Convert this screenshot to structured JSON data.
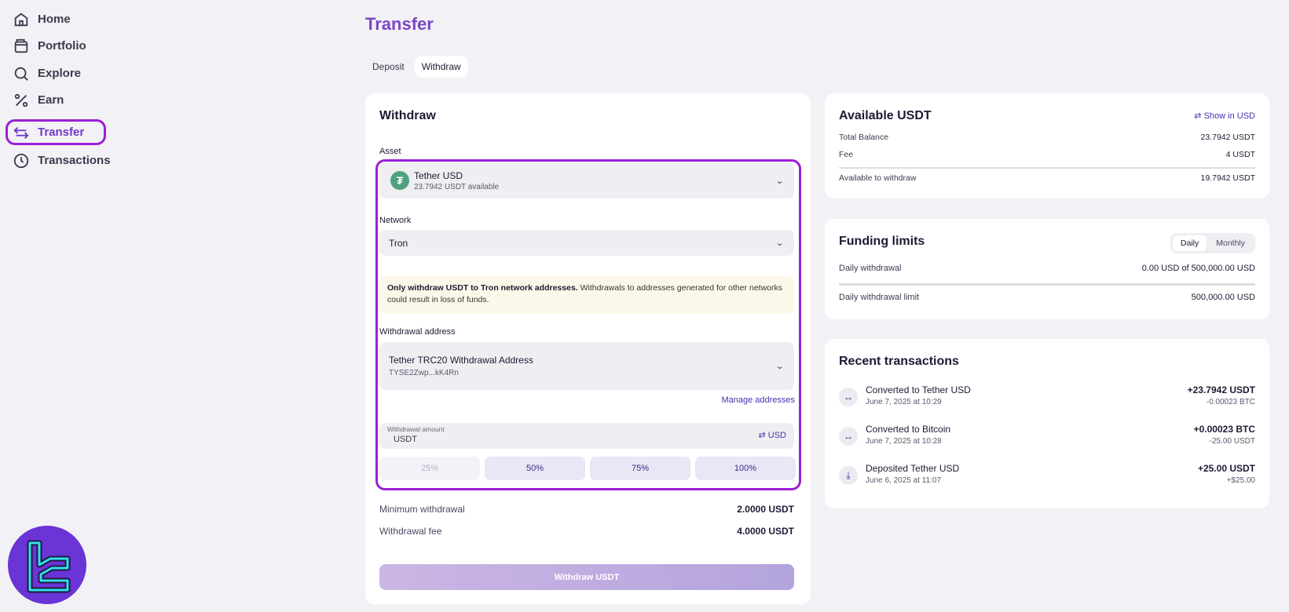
{
  "sidebar": {
    "items": [
      {
        "label": "Home",
        "icon": "home-icon"
      },
      {
        "label": "Portfolio",
        "icon": "wallet-icon"
      },
      {
        "label": "Explore",
        "icon": "search-icon"
      },
      {
        "label": "Earn",
        "icon": "percent-icon"
      },
      {
        "label": "Transfer",
        "icon": "transfer-arrows-icon",
        "active": true
      },
      {
        "label": "Transactions",
        "icon": "clock-icon"
      }
    ]
  },
  "page": {
    "title": "Transfer",
    "tabs": [
      {
        "label": "Deposit"
      },
      {
        "label": "Withdraw",
        "active": true
      }
    ]
  },
  "withdraw": {
    "title": "Withdraw",
    "asset_label": "Asset",
    "asset_name": "Tether USD",
    "asset_available": "23.7942 USDT available",
    "asset_icon": "tether-icon",
    "network_label": "Network",
    "network_value": "Tron",
    "warning_bold": "Only withdraw USDT to Tron network addresses.",
    "warning_text": " Withdrawals to addresses generated for other networks could result in loss of funds.",
    "address_label": "Withdrawal address",
    "address_name": "Tether TRC20 Withdrawal Address",
    "address_value": "TYSE2Zwp...kK4Rn",
    "manage_addresses": "Manage addresses",
    "amount_label": "Withdrawal amount",
    "amount_placeholder": "USDT",
    "currency_toggle": "USD",
    "percent_buttons": [
      "25%",
      "50%",
      "75%",
      "100%"
    ],
    "min_label": "Minimum withdrawal",
    "min_value": "2.0000 USDT",
    "fee_label": "Withdrawal fee",
    "fee_value": "4.0000 USDT",
    "submit_label": "Withdraw USDT"
  },
  "available": {
    "title": "Available USDT",
    "show_in": "Show in USD",
    "total_label": "Total Balance",
    "total_value": "23.7942 USDT",
    "fee_label": "Fee",
    "fee_value": "4 USDT",
    "avail_label": "Available to withdraw",
    "avail_value": "19.7942 USDT"
  },
  "limits": {
    "title": "Funding limits",
    "toggle": [
      "Daily",
      "Monthly"
    ],
    "daily_label": "Daily withdrawal",
    "daily_value": "0.00 USD of 500,000.00 USD",
    "limit_label": "Daily withdrawal limit",
    "limit_value": "500,000.00 USD"
  },
  "recent": {
    "title": "Recent transactions",
    "items": [
      {
        "title": "Converted to Tether USD",
        "date": "June 7, 2025 at 10:29",
        "amount": "+23.7942 USDT",
        "sub": "-0.00023 BTC",
        "icon": "convert-icon"
      },
      {
        "title": "Converted to Bitcoin",
        "date": "June 7, 2025 at 10:28",
        "amount": "+0.00023 BTC",
        "sub": "-25.00 USDT",
        "icon": "convert-icon"
      },
      {
        "title": "Deposited Tether USD",
        "date": "June 6, 2025 at 11:07",
        "amount": "+25.00 USDT",
        "sub": "+$25.00",
        "icon": "download-icon"
      }
    ]
  },
  "colors": {
    "accent": "#7b47c4",
    "highlight": "#9b1fd6",
    "background": "#f2f1f5"
  }
}
